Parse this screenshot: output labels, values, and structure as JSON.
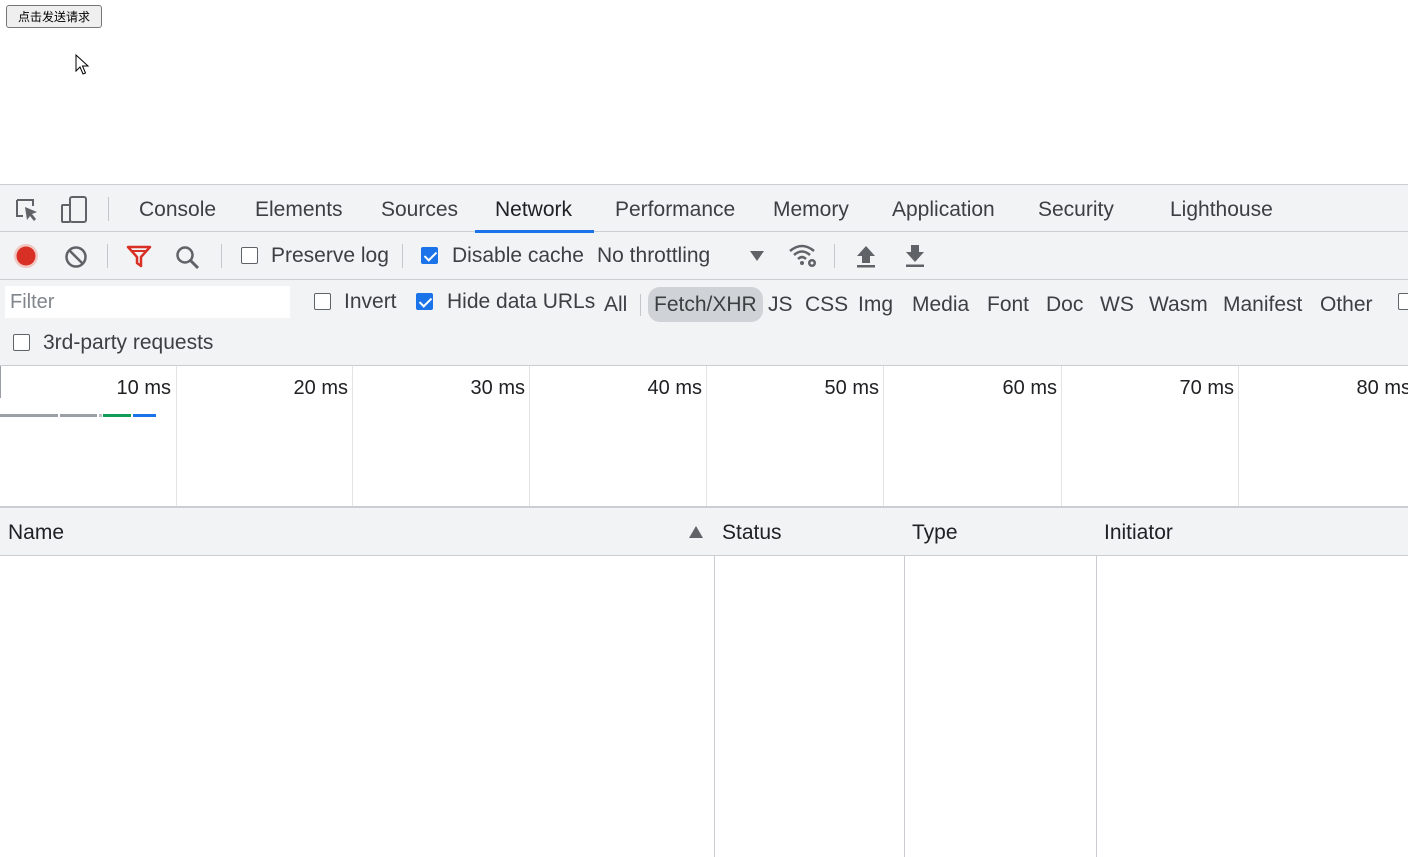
{
  "page": {
    "send_button_label": "点击发送请求"
  },
  "devtools": {
    "tabs": [
      "Console",
      "Elements",
      "Sources",
      "Network",
      "Performance",
      "Memory",
      "Application",
      "Security",
      "Lighthouse"
    ],
    "active_tab": "Network",
    "toolbar": {
      "preserve_log_label": "Preserve log",
      "preserve_log_checked": false,
      "disable_cache_label": "Disable cache",
      "disable_cache_checked": true,
      "throttling_value": "No throttling",
      "record_color": "#d93025",
      "filter_icon_color": "#d93025"
    },
    "filter": {
      "placeholder": "Filter",
      "invert_label": "Invert",
      "invert_checked": false,
      "hide_data_urls_label": "Hide data URLs",
      "hide_data_urls_checked": true,
      "types": [
        "All",
        "Fetch/XHR",
        "JS",
        "CSS",
        "Img",
        "Media",
        "Font",
        "Doc",
        "WS",
        "Wasm",
        "Manifest",
        "Other"
      ],
      "selected_type": "Fetch/XHR",
      "third_party_label": "3rd-party requests",
      "third_party_checked": false
    },
    "timeline": {
      "ticks": [
        "10 ms",
        "20 ms",
        "30 ms",
        "40 ms",
        "50 ms",
        "60 ms",
        "70 ms",
        "80 ms"
      ]
    },
    "table": {
      "columns": [
        "Name",
        "Status",
        "Type",
        "Initiator"
      ],
      "sort_column": "Name",
      "sort_direction": "ascending"
    }
  }
}
